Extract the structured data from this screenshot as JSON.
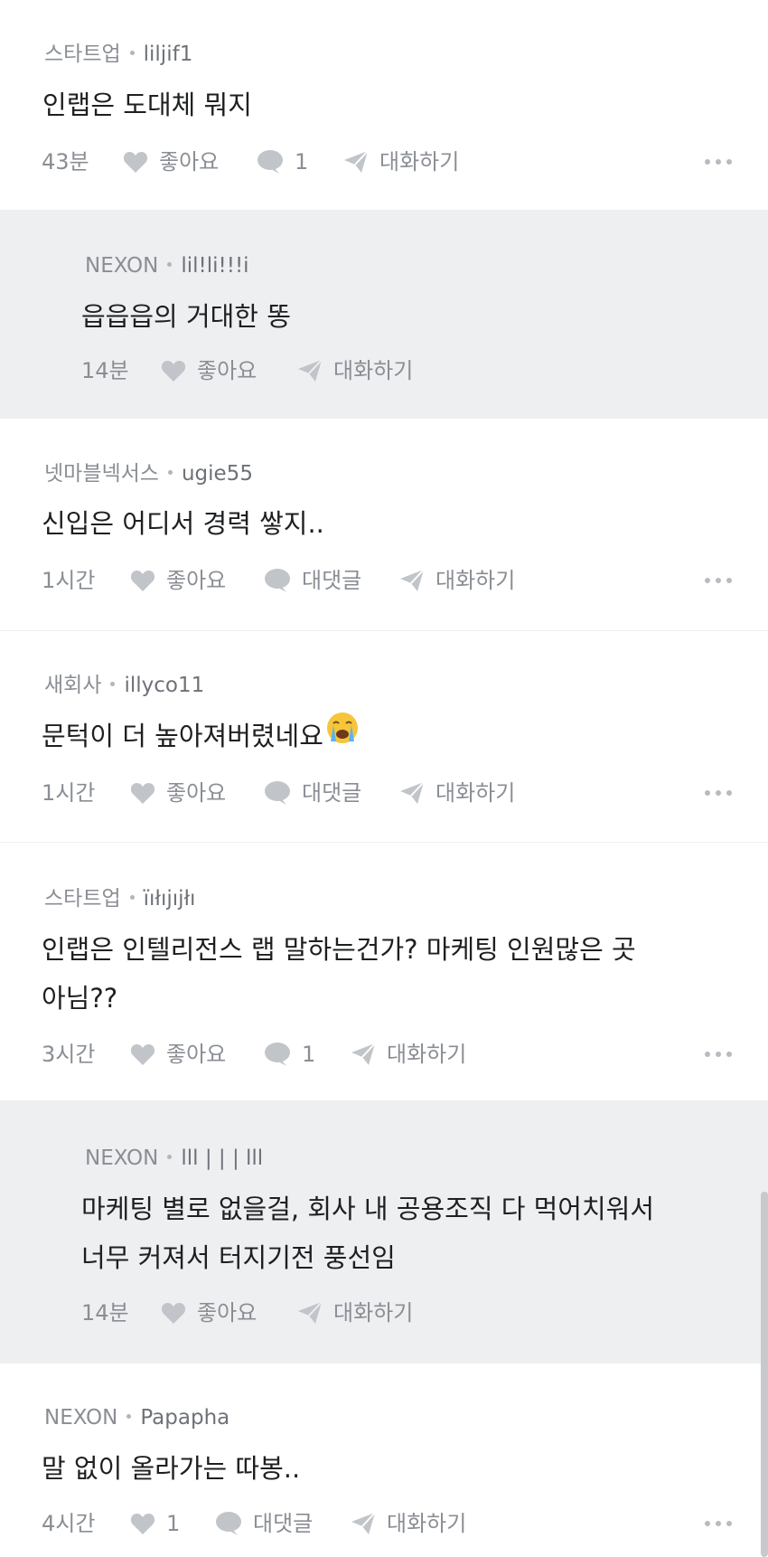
{
  "labels": {
    "like": "좋아요",
    "reply": "대댓글",
    "chat": "대화하기"
  },
  "comments": [
    {
      "company": "스타트업",
      "user": "liljif1",
      "text": "인랩은 도대체 뭐지",
      "time": "43분",
      "like_count": "",
      "reply_count": "1",
      "is_reply": false
    },
    {
      "company": "NEXON",
      "user": "lil!li!!!i",
      "text": "읍읍읍의 거대한 똥",
      "time": "14분",
      "like_count": "",
      "reply_count": null,
      "is_reply": true
    },
    {
      "company": "넷마블넥서스",
      "user": "ugie55",
      "text": "신입은 어디서 경력 쌓지..",
      "time": "1시간",
      "like_count": "",
      "reply_count": "",
      "is_reply": false
    },
    {
      "company": "새회사",
      "user": "illyco11",
      "text": "문턱이 더 높아져버렸네요",
      "emoji": "loudly-crying-face",
      "time": "1시간",
      "like_count": "",
      "reply_count": "",
      "is_reply": false
    },
    {
      "company": "스타트업",
      "user": "ïıłıjıjłı",
      "text_lines": [
        "인랩은 인텔리전스 랩 말하는건가? 마케팅 인원많은 곳",
        "아님??"
      ],
      "time": "3시간",
      "like_count": "",
      "reply_count": "1",
      "is_reply": false
    },
    {
      "company": "NEXON",
      "user": "lll |  |  | lll",
      "text_lines": [
        "마케팅 별로 없을걸, 회사 내 공용조직 다 먹어치워서",
        "너무 커져서 터지기전 풍선임"
      ],
      "time": "14분",
      "like_count": "",
      "reply_count": null,
      "is_reply": true
    },
    {
      "company": "NEXON",
      "user": "Papapha",
      "text": "말 없이 올라가는 따봉..",
      "time": "4시간",
      "like_count": "1",
      "reply_count": "",
      "is_reply": false
    }
  ],
  "colors": {
    "reply_background": "#eeeff1",
    "meta_text": "#8a8e94",
    "icon_gray": "#c1c4c8",
    "body_text": "#1e1f21"
  }
}
